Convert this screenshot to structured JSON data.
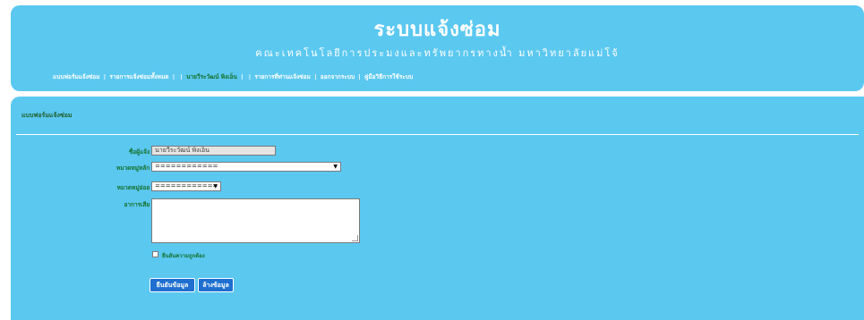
{
  "header": {
    "title": "ระบบแจ้งซ่อม",
    "subtitle": "คณะเทคโนโลยีการประมงและทรัพยากรทางน้ำ มหาวิทยาลัยแม่โจ้"
  },
  "nav": {
    "items": [
      {
        "label": "แบบฟอร์มแจ้งซ่อม",
        "active": false
      },
      {
        "label": "รายการแจ้งซ่อมทั้งหมด",
        "active": false
      },
      {
        "label": "นายวีระวัฒน์ พิงเอ็น",
        "active": true
      },
      {
        "label": "รายการที่ท่านแจ้งซ่อม",
        "active": false
      },
      {
        "label": "ออกจากระบบ",
        "active": false
      },
      {
        "label": "คู่มือวิธีการใช้ระบบ",
        "active": false
      }
    ],
    "separator": "|"
  },
  "form": {
    "title": "แบบฟอร์มแจ้งซ่อม",
    "fields": {
      "name": {
        "label": "ชื่อผู้แจ้ง :",
        "value": "นายวีระวัฒน์ พิงเอ็น"
      },
      "main_category": {
        "label": "หมวดหมู่หลัก :",
        "selected": "============"
      },
      "sub_category": {
        "label": "หมวดหมู่ย่อย :",
        "selected": "============"
      },
      "symptom": {
        "label": "อาการเสีย :",
        "value": ""
      }
    },
    "confirm_label": "ยืนยันความถูกต้อง",
    "submit_label": "ยืนยันข้อมูล",
    "clear_label": "ล้างข้อมูล"
  },
  "colors": {
    "panel": "#5bc8f0",
    "label_green": "#16722f",
    "button_blue": "#1e6fd0"
  },
  "icons": {
    "dropdown": "chevron-down-icon"
  }
}
